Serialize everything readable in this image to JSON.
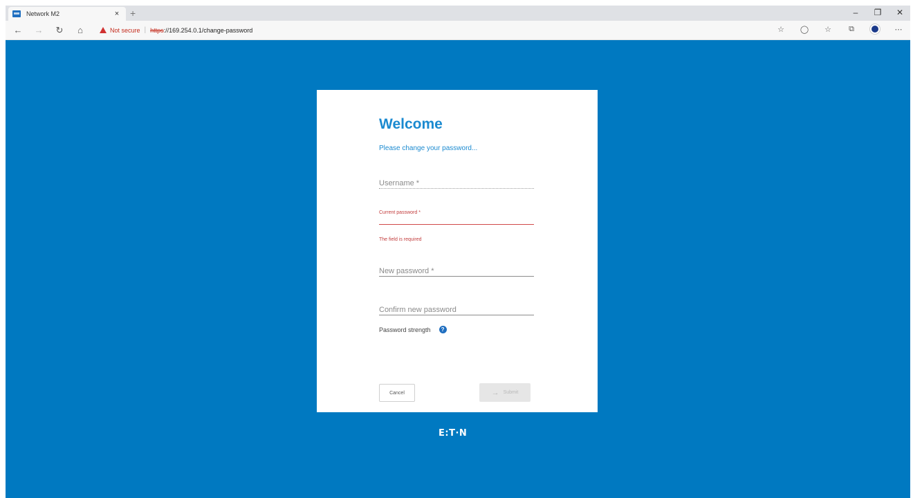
{
  "browser": {
    "tab_title": "Network M2",
    "tab_close": "×",
    "new_tab": "+",
    "window_controls": [
      "–",
      "❐",
      "✕"
    ],
    "nav": {
      "back": "←",
      "forward": "→",
      "refresh": "↻",
      "home": "⌂"
    },
    "address": {
      "security_text": "Not secure",
      "separator": "|",
      "scheme": "https",
      "rest": "://169.254.0.1/change-password"
    },
    "toolbar_icons": [
      "favorites-add-icon",
      "reading-icon",
      "favorites-icon",
      "collections-icon",
      "profile-icon",
      "more-icon"
    ],
    "toolbar_glyphs": [
      "☆",
      "◯",
      "☆",
      "⧉",
      "",
      "⋯"
    ]
  },
  "form": {
    "title": "Welcome",
    "subtitle": "Please change your password...",
    "username": {
      "placeholder": "Username *",
      "value": ""
    },
    "current_password": {
      "label": "Current password *",
      "value": "",
      "error": "The field is required"
    },
    "new_password": {
      "placeholder": "New password *",
      "value": ""
    },
    "confirm_password": {
      "placeholder": "Confirm new password",
      "value": ""
    },
    "strength_label": "Password strength",
    "help_glyph": "?",
    "cancel_label": "Cancel",
    "submit_label": "Submit",
    "submit_arrow": "→"
  },
  "brand": {
    "logo_text": "E:T·N"
  },
  "colors": {
    "background": "#0079c1",
    "accent": "#1b8ad0",
    "error": "#d04848"
  }
}
